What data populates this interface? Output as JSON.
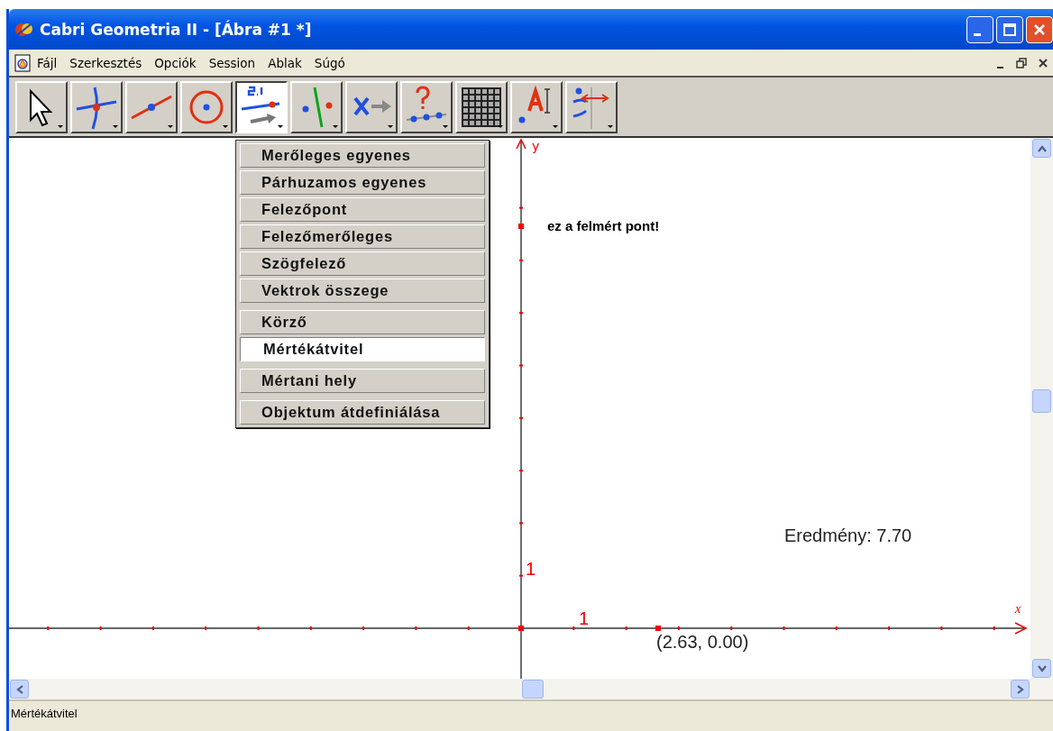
{
  "window": {
    "title": "Cabri Geometria II - [Ábra #1 *]"
  },
  "menu_bar": [
    "Fájl",
    "Szerkesztés",
    "Opciók",
    "Session",
    "Ablak",
    "Súgó"
  ],
  "toolbar": [
    {
      "kind": "pointer",
      "selected": false
    },
    {
      "kind": "points",
      "selected": false
    },
    {
      "kind": "lines",
      "selected": false
    },
    {
      "kind": "curves",
      "selected": false
    },
    {
      "kind": "construct",
      "selected": true
    },
    {
      "kind": "transform",
      "selected": false
    },
    {
      "kind": "macro",
      "selected": false
    },
    {
      "kind": "check",
      "selected": false
    },
    {
      "kind": "calculator",
      "selected": false
    },
    {
      "kind": "text",
      "selected": false
    },
    {
      "kind": "display",
      "selected": false
    }
  ],
  "tool_menu": {
    "groups": [
      {
        "items": [
          {
            "label": "Merőleges egyenes",
            "selected": false
          },
          {
            "label": "Párhuzamos egyenes",
            "selected": false
          },
          {
            "label": "Felezőpont",
            "selected": false
          },
          {
            "label": "Felezőmerőleges",
            "selected": false
          },
          {
            "label": "Szögfelező",
            "selected": false
          },
          {
            "label": "Vektrok összege",
            "selected": false
          }
        ]
      },
      {
        "items": [
          {
            "label": "Körző",
            "selected": false
          },
          {
            "label": "Mértékátvitel",
            "selected": true
          }
        ]
      },
      {
        "items": [
          {
            "label": "Mértani hely",
            "selected": false
          }
        ]
      },
      {
        "items": [
          {
            "label": "Objektum átdefiniálása",
            "selected": false
          }
        ]
      }
    ]
  },
  "canvas": {
    "y_axis_label": "y",
    "x_axis_label": "x",
    "y_unit_label": "1",
    "x_unit_label": "1",
    "note": "ez a felmért pont!",
    "result": "Eredmény: 7.70",
    "point_coords": "(2.63, 0.00)"
  },
  "status_bar": "Mértékátvitel"
}
